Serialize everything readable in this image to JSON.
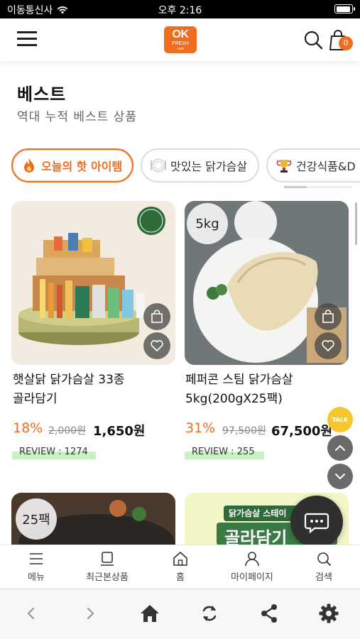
{
  "status_bar": {
    "carrier": "이동통신사",
    "time": "오후 2:16"
  },
  "header": {
    "logo": {
      "line1": "OK",
      "line2": "FRESH",
      "line3": ".com"
    },
    "cart_count": "0"
  },
  "page": {
    "title": "베스트",
    "subtitle": "역대 누적 베스트 상품"
  },
  "categories": [
    {
      "label": "오늘의 핫 아이템",
      "icon": "fire-icon",
      "active": true
    },
    {
      "label": "맛있는 닭가슴살",
      "icon": "plate-icon",
      "active": false
    },
    {
      "label": "건강식품&D",
      "icon": "trophy-icon",
      "active": false
    }
  ],
  "products": [
    {
      "name_line1": "햇살닭 닭가슴살 33종",
      "name_line2": "골라담기",
      "discount": "18%",
      "original_price": "2,000원",
      "price": "1,650원",
      "review": "REVIEW : 1274"
    },
    {
      "badge": "5kg",
      "name_line1": "페퍼콘 스팀 닭가슴살",
      "name_line2": "5kg(200gX25팩)",
      "discount": "31%",
      "original_price": "97,500원",
      "price": "67,500원",
      "review": "REVIEW : 255"
    },
    {
      "badge": "25팩"
    },
    {
      "banner_line1": "닭가슴살 스테이",
      "banner_line2": "골라담기"
    }
  ],
  "floating": {
    "talk_label": "TALK"
  },
  "tab_bar": [
    {
      "label": "메뉴",
      "icon": "menu-icon"
    },
    {
      "label": "최근본상품",
      "icon": "recent-icon"
    },
    {
      "label": "홈",
      "icon": "home-icon"
    },
    {
      "label": "마이페이지",
      "icon": "person-icon"
    },
    {
      "label": "검색",
      "icon": "search-icon"
    }
  ],
  "colors": {
    "accent": "#ee6d1f",
    "review_highlight": "#c9f0c5",
    "talk": "#f7c62f"
  }
}
